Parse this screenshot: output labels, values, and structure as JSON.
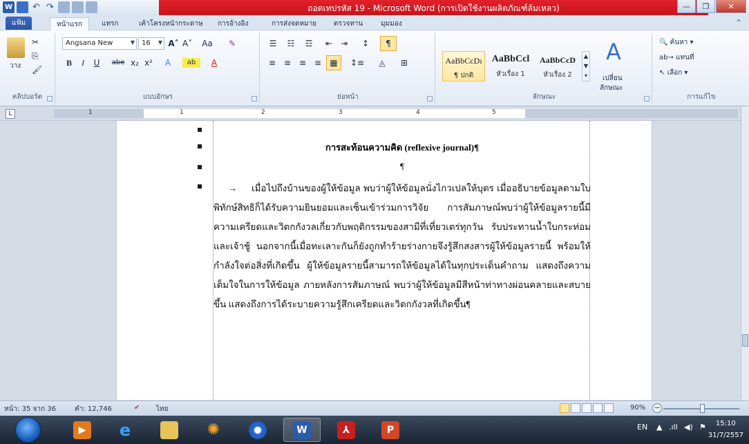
{
  "window": {
    "title": "ถอดเทปรหัส 19 - Microsoft Word (การเปิดใช้งานผลิตภัณฑ์ล้มเหลว)"
  },
  "ribbon_tabs": [
    "แฟ้ม",
    "หน้าแรก",
    "แทรก",
    "เค้าโครงหน้ากระดาษ",
    "การอ้างอิง",
    "การส่งจดหมาย",
    "ตรวจทาน",
    "มุมมอง"
  ],
  "clipboard": {
    "paste_label": "วาง",
    "group_label": "คลิปบอร์ด"
  },
  "font": {
    "name": "Angsana New",
    "size": "16",
    "group_label": "แบบอักษร",
    "buttons": [
      "B",
      "I",
      "U",
      "abe",
      "x₂",
      "x²",
      "Aa"
    ]
  },
  "paragraph": {
    "group_label": "ย่อหน้า"
  },
  "styles": {
    "group_label": "ลักษณะ",
    "items": [
      {
        "sample": "AaBbCcDı",
        "label": "¶ ปกติ"
      },
      {
        "sample": "AaBbCcl",
        "label": "หัวเรื่อง 1"
      },
      {
        "sample": "AaBbCcD",
        "label": "หัวเรื่อง 2"
      }
    ],
    "change_label_1": "เปลี่ยน",
    "change_label_2": "ลักษณะ"
  },
  "editing": {
    "group_label": "การแก้ไข",
    "find": "ค้นหา",
    "replace": "แทนที่",
    "select": "เลือก"
  },
  "ruler": {
    "numbers": [
      "1",
      "1",
      "2",
      "3",
      "4",
      "5"
    ]
  },
  "document": {
    "title": "การสะท้อนความคิด (reflexive journal)¶",
    "empty_para": "¶",
    "body": "เมื่อไปถึงบ้านของผู้ให้ข้อมูล พบว่าผู้ให้ข้อมูลนั่งไกวเปลให้บุตร เมื่ออธิบายข้อมูลตามใบพิทักษ์สิทธิก็ได้รับความยินยอมและเซ็นเข้าร่วมการวิจัย การสัมภาษณ์พบว่าผู้ให้ข้อมูลรายนี้มีความเครียดและวิตกกังวลเกี่ยวกับพฤติกรรมของสามีที่เที่ยวเตร่ทุกวัน รับประทานน้ำใบกระท่อมและเจ้าชู้ นอกจากนี้เมื่อทะเลาะกันก็ยังถูกทำร้ายร่างกายจึงรู้สึกสงสารผู้ให้ข้อมูลรายนี้ พร้อมให้กำลังใจต่อสิ่งที่เกิดขึ้น ผู้ให้ข้อมูลรายนี้สามารถให้ข้อมูลได้ในทุกประเด็นคำถาม แสดงถึงความเต็มใจในการให้ข้อมูล ภายหลังการสัมภาษณ์ พบว่าผู้ให้ข้อมูลมีสีหน้าท่าทางผ่อนคลายและสบายขึ้น แสดงถึงการได้ระบายความรู้สึกเครียดและวิตกกังวลที่เกิดขึ้น¶",
    "tab_arrow": "→"
  },
  "status": {
    "page": "หน้า: 35 จาก 36",
    "words": "คำ: 12,746",
    "language": "ไทย",
    "zoom": "90%",
    "zoom_level": 0.9
  },
  "taskbar": {
    "apps": [
      "media-player",
      "internet-explorer",
      "file-explorer",
      "pinwheel",
      "browser",
      "word",
      "acrobat",
      "powerpoint"
    ],
    "lang": "EN",
    "time": "15:10",
    "date": "31/7/2557"
  },
  "colors": {
    "title_red": "#d11a22",
    "ribbon_bg": "#e4ebf5",
    "word_blue": "#2a5cae"
  }
}
